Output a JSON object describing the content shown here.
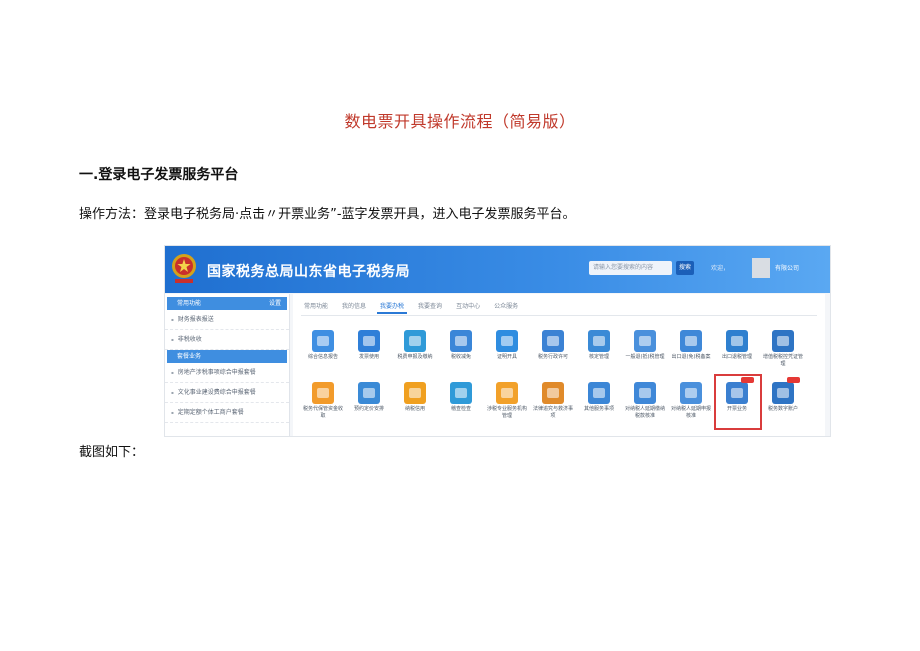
{
  "doc": {
    "title": "数电票开具操作流程（简易版）",
    "heading1": "一.登录电子发票服务平台",
    "method": "操作方法：登录电子税务局·点击〃开票业务”-蓝字发票开具，进入电子发票服务平台。",
    "screenshot_caption": "截图如下："
  },
  "screenshot": {
    "site_title": "国家税务总局山东省电子税务局",
    "search_placeholder": "请输入您要搜索的内容",
    "search_button": "搜索",
    "welcome": "欢迎，",
    "company": "有限公司",
    "sidebar": {
      "header1": "常用功能",
      "header1_more": "设置",
      "items1": [
        "财务报表报送",
        "非税收收"
      ],
      "header2": "套餐业务",
      "items2": [
        "房地产涉税事项综合申报套餐",
        "文化事业建设费综合申报套餐",
        "定期定额个体工商户套餐"
      ]
    },
    "tabs": [
      "常用功能",
      "我的信息",
      "我要办税",
      "我要查询",
      "互动中心",
      "公众服务"
    ],
    "active_tab": 2,
    "tiles_row1": [
      {
        "label": "综合信息报告",
        "color": "#3f8fe2"
      },
      {
        "label": "发票使用",
        "color": "#2f7fd8"
      },
      {
        "label": "税费申报及缴纳",
        "color": "#2f9ad8"
      },
      {
        "label": "税收减免",
        "color": "#3a86d8"
      },
      {
        "label": "证明开具",
        "color": "#2f8de0"
      },
      {
        "label": "税务行政许可",
        "color": "#3b82d4"
      },
      {
        "label": "核定管理",
        "color": "#3a8ad6"
      },
      {
        "label": "一般退(抵)税管理",
        "color": "#4a90dc"
      },
      {
        "label": "出口退(免)税备案",
        "color": "#3f88d8"
      },
      {
        "label": "出口退税管理",
        "color": "#2f80cf"
      },
      {
        "label": "增值税税控凭证管理",
        "color": "#2e74c4"
      }
    ],
    "tiles_row2": [
      {
        "label": "税务代保管资金收取",
        "color": "#f29b2b"
      },
      {
        "label": "预约定价安排",
        "color": "#3a8ad6"
      },
      {
        "label": "纳税信用",
        "color": "#f0a020"
      },
      {
        "label": "稽查检查",
        "color": "#2f9ad8"
      },
      {
        "label": "涉税专业服务机构管理",
        "color": "#f2a12a"
      },
      {
        "label": "法律追究与救济事项",
        "color": "#e08a2a"
      },
      {
        "label": "其他服务事项",
        "color": "#3b86d6"
      },
      {
        "label": "对纳税人延期缴纳税款核准",
        "color": "#3f88d8"
      },
      {
        "label": "对纳税人延期申报核准",
        "color": "#4a90dc"
      },
      {
        "label": "开票业务",
        "color": "#3a7fd0"
      },
      {
        "label": "税务数字账户",
        "color": "#2e74c4"
      }
    ]
  }
}
